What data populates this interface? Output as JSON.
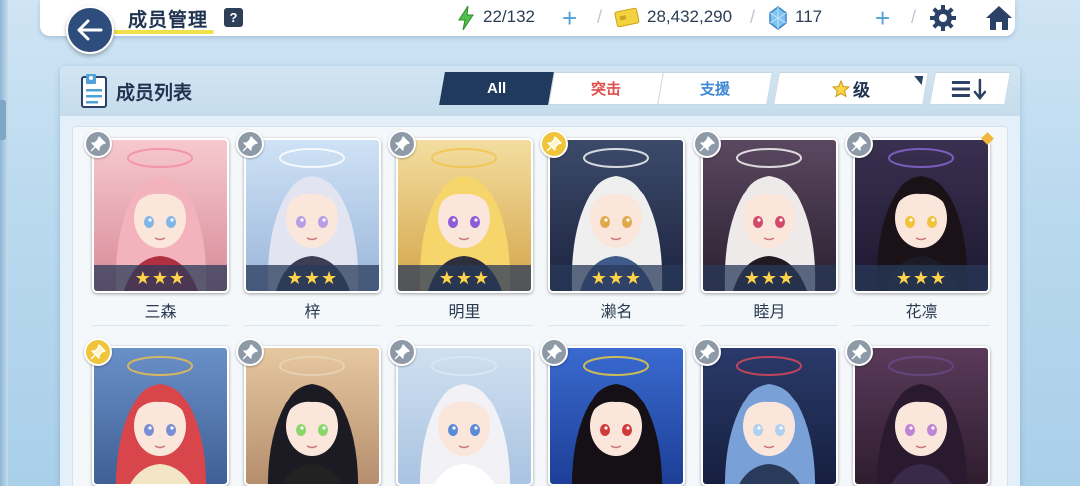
{
  "header": {
    "title": "成员管理",
    "help": "?",
    "ap": "22/132",
    "credits": "28,432,290",
    "gems": "117",
    "plus": "+",
    "sep": "/"
  },
  "panel": {
    "title": "成员列表",
    "tabs": {
      "all": "All",
      "strike": "突击",
      "support": "支援"
    },
    "sort_label": "级",
    "sort_star": "☆"
  },
  "colors": {
    "accent_dark": "#1f3a5c",
    "strike_red": "#e24c4c",
    "support_blue": "#3f88d4",
    "star_gold": "#ffd34a"
  },
  "row1": [
    {
      "name": "三森",
      "stars": "★★★",
      "pinned": false
    },
    {
      "name": "梓",
      "stars": "★★★",
      "pinned": false
    },
    {
      "name": "明里",
      "stars": "★★★",
      "pinned": false
    },
    {
      "name": "濑名",
      "stars": "★★★",
      "pinned": true
    },
    {
      "name": "睦月",
      "stars": "★★★",
      "pinned": false
    },
    {
      "name": "花凛",
      "stars": "★★★",
      "pinned": false
    }
  ],
  "row2": [
    {
      "pinned": true
    },
    {
      "pinned": false
    },
    {
      "pinned": false
    },
    {
      "pinned": false
    },
    {
      "pinned": false
    },
    {
      "pinned": false
    }
  ]
}
